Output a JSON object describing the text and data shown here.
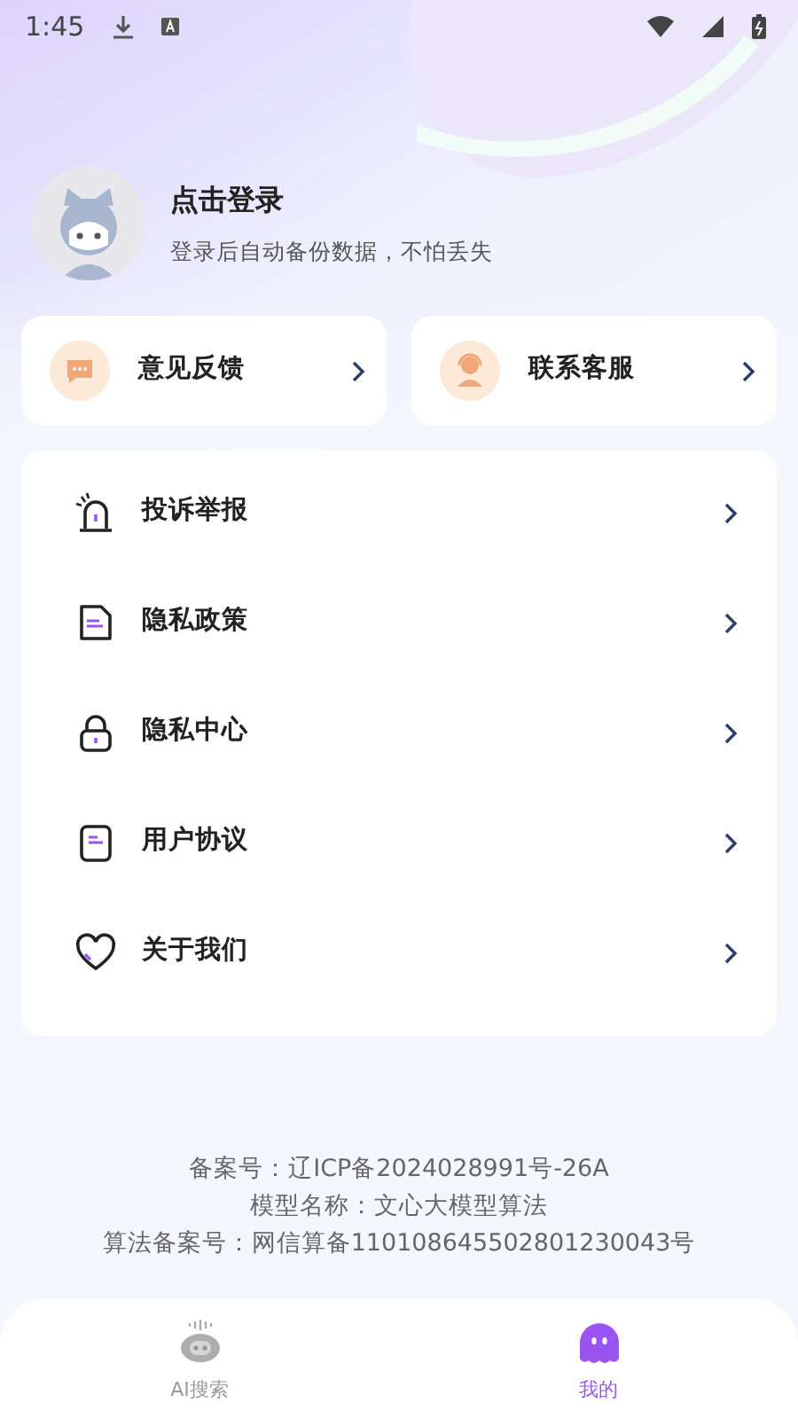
{
  "status_bar": {
    "time": "1:45"
  },
  "profile": {
    "title": "点击登录",
    "subtitle": "登录后自动备份数据，不怕丢失"
  },
  "shortcuts": [
    {
      "label": "意见反馈"
    },
    {
      "label": "联系客服"
    }
  ],
  "menu": [
    {
      "label": "投诉举报"
    },
    {
      "label": "隐私政策"
    },
    {
      "label": "隐私中心"
    },
    {
      "label": "用户协议"
    },
    {
      "label": "关于我们"
    }
  ],
  "footer": [
    "备案号：辽ICP备2024028991号-26A",
    "模型名称：文心大模型算法",
    "算法备案号：网信算备110108645502801230043号"
  ],
  "tabs": [
    {
      "label": "AI搜索",
      "selected": false
    },
    {
      "label": "我的",
      "selected": true
    }
  ]
}
